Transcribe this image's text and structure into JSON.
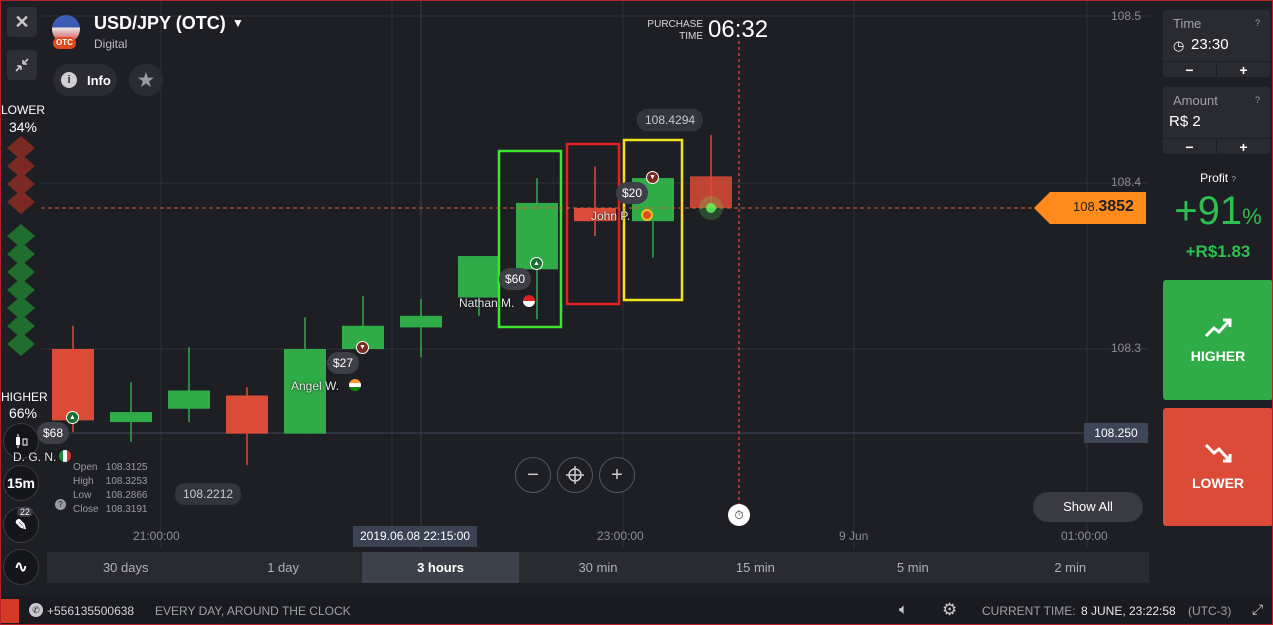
{
  "asset": {
    "name": "USD/JPY (OTC)",
    "type": "Digital",
    "badge": "OTC"
  },
  "info_label": "Info",
  "purchase_time": {
    "label_line1": "PURCHASE",
    "label_line2": "TIME",
    "value": "06:32"
  },
  "sentiment": {
    "lower_label": "LOWER",
    "lower_pct": "34%",
    "higher_label": "HIGHER",
    "higher_pct": "66%"
  },
  "left_tools": {
    "timeframe": "15m",
    "indicator_count": "22"
  },
  "chart": {
    "current_price_prefix": "108.",
    "current_price_suffix": "3852",
    "level_label": "108.250",
    "high_tag": "108.4294",
    "low_tag": "108.2212",
    "y_ticks": [
      "108.5",
      "108.4",
      "108.3"
    ],
    "x_ticks": [
      "21:00:00",
      "23:00:00",
      "9 Jun",
      "01:00:00"
    ],
    "cursor_time": "2019.06.08 22:15:00",
    "show_all": "Show All",
    "ohlc": {
      "open_label": "Open",
      "open": "108.3125",
      "high_label": "High",
      "high": "108.3253",
      "low_label": "Low",
      "low": "108.2866",
      "close_label": "Close",
      "close": "108.3191"
    },
    "trades": [
      {
        "amount": "$68",
        "trader": "D. G. N."
      },
      {
        "amount": "$27",
        "trader": "Angel W."
      },
      {
        "amount": "$60",
        "trader": "Nathan M."
      },
      {
        "amount": "$20",
        "trader": "John P."
      }
    ],
    "candles": [
      {
        "o": 108.3,
        "h": 108.314,
        "l": 108.25,
        "c": 108.257
      },
      {
        "o": 108.256,
        "h": 108.28,
        "l": 108.244,
        "c": 108.262
      },
      {
        "o": 108.264,
        "h": 108.301,
        "l": 108.256,
        "c": 108.275
      },
      {
        "o": 108.272,
        "h": 108.277,
        "l": 108.23,
        "c": 108.249
      },
      {
        "o": 108.249,
        "h": 108.319,
        "l": 108.249,
        "c": 108.3
      },
      {
        "o": 108.3,
        "h": 108.332,
        "l": 108.3,
        "c": 108.314
      },
      {
        "o": 108.313,
        "h": 108.33,
        "l": 108.295,
        "c": 108.32
      },
      {
        "o": 108.331,
        "h": 108.345,
        "l": 108.32,
        "c": 108.356
      },
      {
        "o": 108.348,
        "h": 108.403,
        "l": 108.318,
        "c": 108.388
      },
      {
        "o": 108.385,
        "h": 108.41,
        "l": 108.368,
        "c": 108.377
      },
      {
        "o": 108.377,
        "h": 108.406,
        "l": 108.355,
        "c": 108.403
      },
      {
        "o": 108.404,
        "h": 108.429,
        "l": 108.385,
        "c": 108.385
      }
    ]
  },
  "periods": [
    "30 days",
    "1 day",
    "3 hours",
    "30 min",
    "15 min",
    "5 min",
    "2 min"
  ],
  "active_period": "3 hours",
  "footer": {
    "phone": "+556135500638",
    "support": "EVERY DAY, AROUND THE CLOCK",
    "current_time_label": "CURRENT TIME:",
    "current_time_value": "8 JUNE, 23:22:58",
    "timezone": "(UTC-3)"
  },
  "right_panel": {
    "time_label": "Time",
    "time_value": "23:30",
    "amount_label": "Amount",
    "amount_value": "R$ 2",
    "minus": "−",
    "plus": "+",
    "profit_label": "Profit",
    "profit_pct": "+91",
    "profit_pct_sign": "%",
    "profit_amount": "+R$1.83",
    "higher_label": "HIGHER",
    "lower_label": "LOWER"
  },
  "colors": {
    "up": "#2fab48",
    "down": "#dc4b37",
    "accent": "#ff8c1a",
    "higher_btn": "#2fab48",
    "lower_btn": "#dc4b37",
    "box_green": "#3ee630",
    "box_red": "#e32020",
    "box_yellow": "#f0e020"
  }
}
